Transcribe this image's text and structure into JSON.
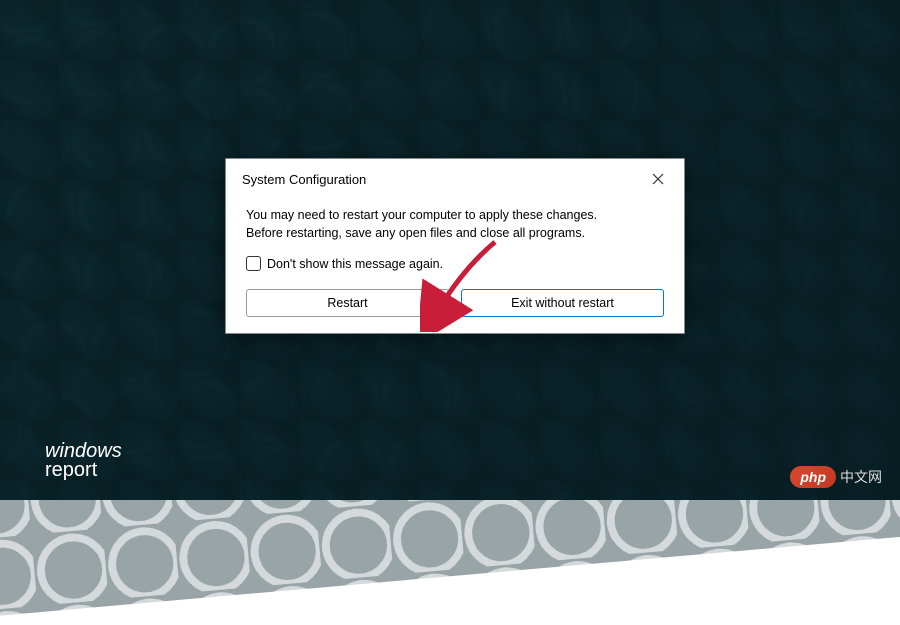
{
  "dialog": {
    "title": "System Configuration",
    "message_line1": "You may need to restart your computer to apply these changes.",
    "message_line2": "Before restarting, save any open files and close all programs.",
    "checkbox_label": "Don't show this message again.",
    "restart_label": "Restart",
    "exit_label": "Exit without restart"
  },
  "watermark": {
    "brand_line1": "windows",
    "brand_line2": "report",
    "php_label": "php",
    "cn_label": "中文网"
  }
}
